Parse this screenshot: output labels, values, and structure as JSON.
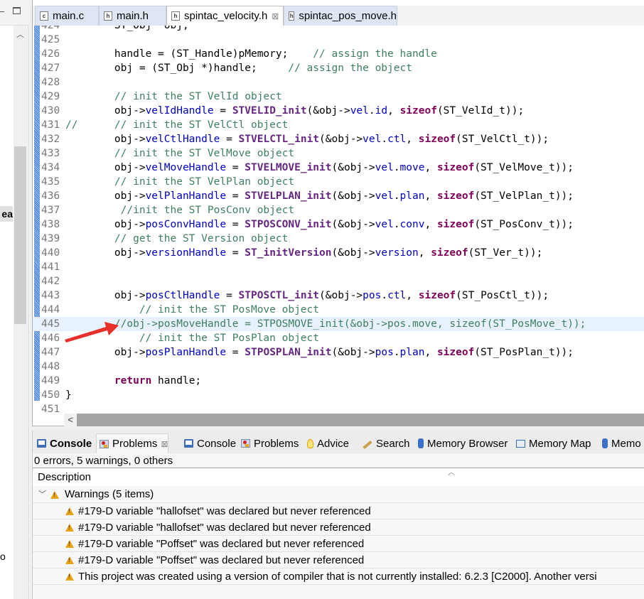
{
  "left_panel": {
    "truncated_label_1": "ea",
    "truncated_label_2": "o"
  },
  "editor": {
    "tabs": [
      {
        "label": "main.c",
        "icon": "c-file-icon",
        "active": false
      },
      {
        "label": "main.h",
        "icon": "h-file-icon",
        "active": false
      },
      {
        "label": "spintac_velocity.h",
        "icon": "h-file-icon",
        "active": true,
        "closable": true
      },
      {
        "label": "spintac_pos_move.h",
        "icon": "h-file-icon",
        "active": false
      }
    ],
    "close_glyph": "⊠",
    "current_line": 445,
    "lines": [
      {
        "n": "424",
        "marker": "",
        "tokens": [
          {
            "t": "    ST_Obj *obj;",
            "c": ""
          }
        ]
      },
      {
        "n": "425",
        "marker": "",
        "tokens": []
      },
      {
        "n": "426",
        "marker": "",
        "tokens": [
          {
            "t": "    handle = (ST_Handle)pMemory;    ",
            "c": ""
          },
          {
            "t": "// assign the handle",
            "c": "cm"
          }
        ]
      },
      {
        "n": "427",
        "marker": "",
        "tokens": [
          {
            "t": "    obj = (ST_Obj *)handle;     ",
            "c": ""
          },
          {
            "t": "// assign the object",
            "c": "cm"
          }
        ]
      },
      {
        "n": "428",
        "marker": "",
        "tokens": []
      },
      {
        "n": "429",
        "marker": "",
        "tokens": [
          {
            "t": "    // init the ST VelId object",
            "c": "cm"
          }
        ]
      },
      {
        "n": "430",
        "marker": "",
        "tokens": [
          {
            "t": "    obj->",
            "c": ""
          },
          {
            "t": "velIdHandle",
            "c": "fld"
          },
          {
            "t": " = ",
            "c": ""
          },
          {
            "t": "STVELID_init",
            "c": "fn"
          },
          {
            "t": "(&obj->",
            "c": ""
          },
          {
            "t": "vel",
            "c": "fld"
          },
          {
            "t": ".",
            "c": ""
          },
          {
            "t": "id",
            "c": "fld"
          },
          {
            "t": ", ",
            "c": ""
          },
          {
            "t": "sizeof",
            "c": "kw"
          },
          {
            "t": "(ST_VelId_t));",
            "c": ""
          }
        ]
      },
      {
        "n": "431",
        "marker": "//",
        "tokens": [
          {
            "t": "    // init the ST VelCtl object",
            "c": "cm"
          }
        ]
      },
      {
        "n": "432",
        "marker": "",
        "tokens": [
          {
            "t": "    obj->",
            "c": ""
          },
          {
            "t": "velCtlHandle",
            "c": "fld"
          },
          {
            "t": " = ",
            "c": ""
          },
          {
            "t": "STVELCTL_init",
            "c": "fn"
          },
          {
            "t": "(&obj->",
            "c": ""
          },
          {
            "t": "vel",
            "c": "fld"
          },
          {
            "t": ".",
            "c": ""
          },
          {
            "t": "ctl",
            "c": "fld"
          },
          {
            "t": ", ",
            "c": ""
          },
          {
            "t": "sizeof",
            "c": "kw"
          },
          {
            "t": "(ST_VelCtl_t));",
            "c": ""
          }
        ]
      },
      {
        "n": "433",
        "marker": "",
        "tokens": [
          {
            "t": "    // init the ST VelMove object",
            "c": "cm"
          }
        ]
      },
      {
        "n": "434",
        "marker": "",
        "tokens": [
          {
            "t": "    obj->",
            "c": ""
          },
          {
            "t": "velMoveHandle",
            "c": "fld"
          },
          {
            "t": " = ",
            "c": ""
          },
          {
            "t": "STVELMOVE_init",
            "c": "fn"
          },
          {
            "t": "(&obj->",
            "c": ""
          },
          {
            "t": "vel",
            "c": "fld"
          },
          {
            "t": ".",
            "c": ""
          },
          {
            "t": "move",
            "c": "fld"
          },
          {
            "t": ", ",
            "c": ""
          },
          {
            "t": "sizeof",
            "c": "kw"
          },
          {
            "t": "(ST_VelMove_t));",
            "c": ""
          }
        ]
      },
      {
        "n": "435",
        "marker": "",
        "tokens": [
          {
            "t": "    // init the ST VelPlan object",
            "c": "cm"
          }
        ]
      },
      {
        "n": "436",
        "marker": "",
        "tokens": [
          {
            "t": "    obj->",
            "c": ""
          },
          {
            "t": "velPlanHandle",
            "c": "fld"
          },
          {
            "t": " = ",
            "c": ""
          },
          {
            "t": "STVELPLAN_init",
            "c": "fn"
          },
          {
            "t": "(&obj->",
            "c": ""
          },
          {
            "t": "vel",
            "c": "fld"
          },
          {
            "t": ".",
            "c": ""
          },
          {
            "t": "plan",
            "c": "fld"
          },
          {
            "t": ", ",
            "c": ""
          },
          {
            "t": "sizeof",
            "c": "kw"
          },
          {
            "t": "(ST_VelPlan_t));",
            "c": ""
          }
        ]
      },
      {
        "n": "437",
        "marker": "",
        "tokens": [
          {
            "t": "     //init the ST PosConv object",
            "c": "cm"
          }
        ]
      },
      {
        "n": "438",
        "marker": "",
        "tokens": [
          {
            "t": "    obj->",
            "c": ""
          },
          {
            "t": "posConvHandle",
            "c": "fld"
          },
          {
            "t": " = ",
            "c": ""
          },
          {
            "t": "STPOSCONV_init",
            "c": "fn"
          },
          {
            "t": "(&obj->",
            "c": ""
          },
          {
            "t": "vel",
            "c": "fld"
          },
          {
            "t": ".",
            "c": ""
          },
          {
            "t": "conv",
            "c": "fld"
          },
          {
            "t": ", ",
            "c": ""
          },
          {
            "t": "sizeof",
            "c": "kw"
          },
          {
            "t": "(ST_PosConv_t));",
            "c": ""
          }
        ]
      },
      {
        "n": "439",
        "marker": "",
        "tokens": [
          {
            "t": "    // get the ST Version object",
            "c": "cm"
          }
        ]
      },
      {
        "n": "440",
        "marker": "",
        "tokens": [
          {
            "t": "    obj->",
            "c": ""
          },
          {
            "t": "versionHandle",
            "c": "fld"
          },
          {
            "t": " = ",
            "c": ""
          },
          {
            "t": "ST_initVersion",
            "c": "fn"
          },
          {
            "t": "(&obj->",
            "c": ""
          },
          {
            "t": "version",
            "c": "fld"
          },
          {
            "t": ", ",
            "c": ""
          },
          {
            "t": "sizeof",
            "c": "kw"
          },
          {
            "t": "(ST_Ver_t));",
            "c": ""
          }
        ]
      },
      {
        "n": "441",
        "marker": "",
        "tokens": []
      },
      {
        "n": "442",
        "marker": "",
        "tokens": []
      },
      {
        "n": "443",
        "marker": "",
        "tokens": [
          {
            "t": "    obj->",
            "c": ""
          },
          {
            "t": "posCtlHandle",
            "c": "fld"
          },
          {
            "t": " = ",
            "c": ""
          },
          {
            "t": "STPOSCTL_init",
            "c": "fn"
          },
          {
            "t": "(&obj->",
            "c": ""
          },
          {
            "t": "pos",
            "c": "fld"
          },
          {
            "t": ".",
            "c": ""
          },
          {
            "t": "ctl",
            "c": "fld"
          },
          {
            "t": ", ",
            "c": ""
          },
          {
            "t": "sizeof",
            "c": "kw"
          },
          {
            "t": "(ST_PosCtl_t));",
            "c": ""
          }
        ]
      },
      {
        "n": "444",
        "marker": "",
        "tokens": [
          {
            "t": "        // init the ST PosMove object",
            "c": "cm"
          }
        ]
      },
      {
        "n": "445",
        "marker": "",
        "tokens": [
          {
            "t": "    //obj->posMoveHandle = STPOSMOVE_init(&obj->pos.move, sizeof(ST_PosMove_t));",
            "c": "cm"
          }
        ]
      },
      {
        "n": "446",
        "marker": "",
        "tokens": [
          {
            "t": "        // init the ST PosPlan object",
            "c": "cm"
          }
        ]
      },
      {
        "n": "447",
        "marker": "",
        "tokens": [
          {
            "t": "    obj->",
            "c": ""
          },
          {
            "t": "posPlanHandle",
            "c": "fld"
          },
          {
            "t": " = ",
            "c": ""
          },
          {
            "t": "STPOSPLAN_init",
            "c": "fn"
          },
          {
            "t": "(&obj->",
            "c": ""
          },
          {
            "t": "pos",
            "c": "fld"
          },
          {
            "t": ".",
            "c": ""
          },
          {
            "t": "plan",
            "c": "fld"
          },
          {
            "t": ", ",
            "c": ""
          },
          {
            "t": "sizeof",
            "c": "kw"
          },
          {
            "t": "(ST_PosPlan_t));",
            "c": ""
          }
        ]
      },
      {
        "n": "448",
        "marker": "",
        "tokens": []
      },
      {
        "n": "449",
        "marker": "",
        "tokens": [
          {
            "t": "    ",
            "c": ""
          },
          {
            "t": "return",
            "c": "kw"
          },
          {
            "t": " handle;",
            "c": ""
          }
        ]
      },
      {
        "n": "450",
        "marker": "}",
        "tokens": []
      },
      {
        "n": "451",
        "marker": "",
        "tokens": []
      }
    ],
    "hscroll_left_glyph": "<"
  },
  "bottom_panel": {
    "tabs": [
      {
        "label": "Console",
        "icon": "console",
        "bold": true
      },
      {
        "label": "Problems",
        "icon": "problems",
        "active": true,
        "closable": true
      },
      {
        "label": "Console",
        "icon": "console"
      },
      {
        "label": "Problems",
        "icon": "problems"
      },
      {
        "label": "Advice",
        "icon": "advice"
      },
      {
        "label": "Search",
        "icon": "search"
      },
      {
        "label": "Memory Browser",
        "icon": "memory"
      },
      {
        "label": "Memory Map",
        "icon": "memmap"
      },
      {
        "label": "Memo",
        "icon": "memory"
      }
    ],
    "summary": "0 errors, 5 warnings, 0 others",
    "column_header": "Description",
    "group": {
      "label": "Warnings (5 items)",
      "expanded": true
    },
    "warnings": [
      "#179-D variable \"hallofset\" was declared but never referenced",
      "#179-D variable \"hallofset\" was declared but never referenced",
      "#179-D variable \"Poffset\" was declared but never referenced",
      "#179-D variable \"Poffset\" was declared but never referenced",
      "This project was created using a version of compiler that is not currently installed: 6.2.3 [C2000]. Another versi"
    ]
  },
  "colors": {
    "comment": "#3f7f5f",
    "field": "#0000c0",
    "function": "#642880",
    "keyword": "#7f0055",
    "current_line": "#e8f2fe",
    "annotation_arrow": "#e8302a"
  }
}
